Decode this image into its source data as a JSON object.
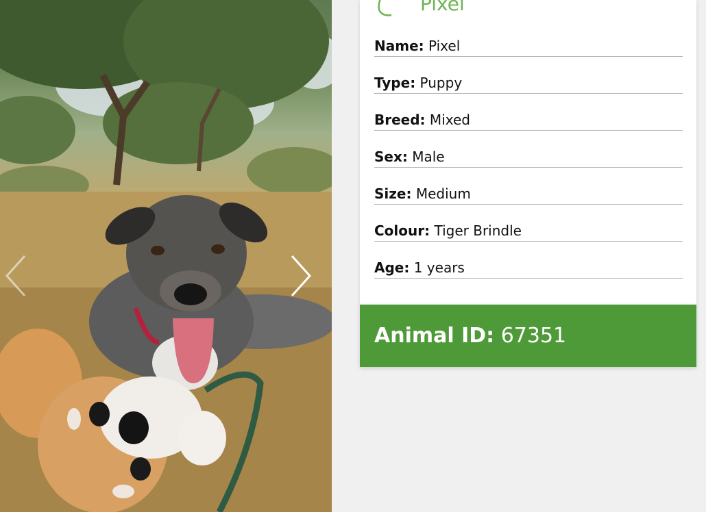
{
  "gallery": {
    "photo_alt": "dog-photo",
    "prev_icon": "chevron-left-icon",
    "next_icon": "chevron-right-icon"
  },
  "card": {
    "icon": "animal-outline-icon",
    "title": "Pixel",
    "details": [
      {
        "label": "Name:",
        "value": "Pixel"
      },
      {
        "label": "Type:",
        "value": "Puppy"
      },
      {
        "label": "Breed:",
        "value": "Mixed"
      },
      {
        "label": "Sex:",
        "value": "Male"
      },
      {
        "label": "Size:",
        "value": "Medium"
      },
      {
        "label": "Colour:",
        "value": "Tiger Brindle"
      },
      {
        "label": "Age:",
        "value": "1 years"
      }
    ]
  },
  "animal_id": {
    "label": "Animal ID:",
    "value": "67351"
  },
  "colors": {
    "accent": "#6cb552",
    "id_bar": "#4e9a38",
    "background": "#f0f0f0"
  }
}
